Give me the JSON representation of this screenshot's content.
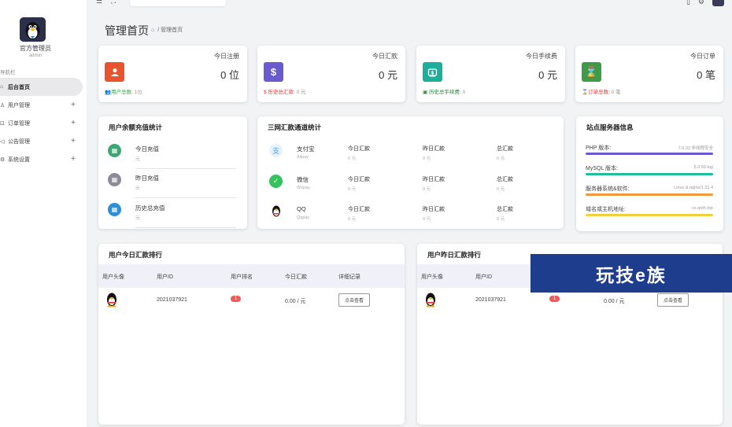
{
  "sidebar": {
    "user_name": "官方管理员",
    "user_role": "admin",
    "nav_title": "导航栏",
    "items": [
      {
        "label": "后台首页",
        "icon": "home-icon"
      },
      {
        "label": "用户管理",
        "icon": "user-icon"
      },
      {
        "label": "订单管理",
        "icon": "cart-icon"
      },
      {
        "label": "公告管理",
        "icon": "megaphone-icon"
      },
      {
        "label": "系统设置",
        "icon": "gear-icon"
      }
    ]
  },
  "header": {
    "title": "管理首页",
    "breadcrumb": "管理首页"
  },
  "stats": [
    {
      "label": "今日注册",
      "value": "0 位",
      "foot_label": "用户总数:",
      "foot_value": "1位",
      "color": "#e8542e",
      "foot_color": "#3aa34c"
    },
    {
      "label": "今日汇款",
      "value": "0 元",
      "foot_label": "历史总汇款:",
      "foot_value": "0 元",
      "color": "#6a5acd",
      "foot_color": "#e03a3a"
    },
    {
      "label": "今日手续费",
      "value": "0 元",
      "foot_label": "历史总手续费:",
      "foot_value": "0",
      "color": "#1fae9c",
      "foot_color": "#2a8a3c"
    },
    {
      "label": "今日订单",
      "value": "0 笔",
      "foot_label": "订单总数:",
      "foot_value": "0 笔",
      "color": "#3e9b46",
      "foot_color": "#e03a3a"
    }
  ],
  "recharge": {
    "title": "用户余额充值统计",
    "rows": [
      {
        "label": "今日充值",
        "value": "元",
        "color": "#3aa870"
      },
      {
        "label": "昨日充值",
        "value": "元",
        "color": "#8c8c99"
      },
      {
        "label": "历史总充值",
        "value": "元",
        "color": "#2e8fd6"
      }
    ]
  },
  "channels": {
    "title": "三网汇款通道统计",
    "rows": [
      {
        "name": "支付宝",
        "sub": "Alipay",
        "color": "#4aa3f0",
        "today": "今日汇款",
        "today_v": "0 元",
        "yesterday": "昨日汇款",
        "yesterday_v": "0 元",
        "total": "总汇款",
        "total_v": "0 元"
      },
      {
        "name": "微信",
        "sub": "Wxpay",
        "color": "#33c25c",
        "today": "今日汇款",
        "today_v": "0 元",
        "yesterday": "昨日汇款",
        "yesterday_v": "0 元",
        "total": "总汇款",
        "total_v": "0 元"
      },
      {
        "name": "QQ",
        "sub": "Qqpay",
        "color": "#222222",
        "today": "今日汇款",
        "today_v": "0 元",
        "yesterday": "昨日汇款",
        "yesterday_v": "0 元",
        "total": "总汇款",
        "total_v": "0 元"
      }
    ]
  },
  "server": {
    "title": "站点服务器信息",
    "rows": [
      {
        "key": "PHP 版本:",
        "value": "7.0.33 非线程安全",
        "color": "#6a5acd"
      },
      {
        "key": "MySQL 版本:",
        "value": "5.0.60-log",
        "color": "#1fbf9c"
      },
      {
        "key": "服务器系统&软件:",
        "value": "Linux & nginx/1.21.4",
        "color": "#f09a3a"
      },
      {
        "key": "域名或主机地址:",
        "value": "cs.qoth.top",
        "color": "#f2d13a"
      }
    ]
  },
  "rank_today": {
    "title": "用户今日汇款排行",
    "headers": [
      "用户头像",
      "用户ID",
      "用户排名",
      "今日汇款",
      "详细记录"
    ],
    "row": {
      "id": "2021037921",
      "rank": "1",
      "amount": "0.00 / 元",
      "button": "点击查看"
    }
  },
  "rank_yesterday": {
    "title": "用户昨日汇款排行",
    "headers": [
      "用户头像",
      "用户ID"
    ],
    "row": {
      "id": "2021037921",
      "rank": "1",
      "amount": "0.00 / 元",
      "button": "点击查看"
    }
  },
  "watermark": "玩技e族"
}
